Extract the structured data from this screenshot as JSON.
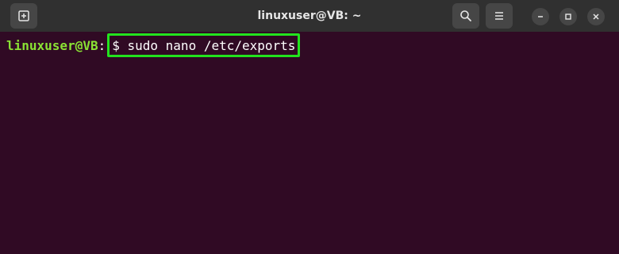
{
  "window": {
    "title": "linuxuser@VB: ~"
  },
  "titlebar": {
    "new_tab_icon": "new-tab-icon",
    "search_icon": "search-icon",
    "menu_icon": "hamburger-menu-icon",
    "minimize_icon": "minimize-icon",
    "maximize_icon": "maximize-icon",
    "close_icon": "close-icon"
  },
  "terminal": {
    "prompt_user": "linuxuser@VB",
    "prompt_sep": ":",
    "command": "$ sudo nano /etc/exports"
  },
  "colors": {
    "terminal_bg": "#300a24",
    "titlebar_bg": "#303030",
    "prompt_green": "#8ae234",
    "highlight_green": "#22e31e"
  }
}
